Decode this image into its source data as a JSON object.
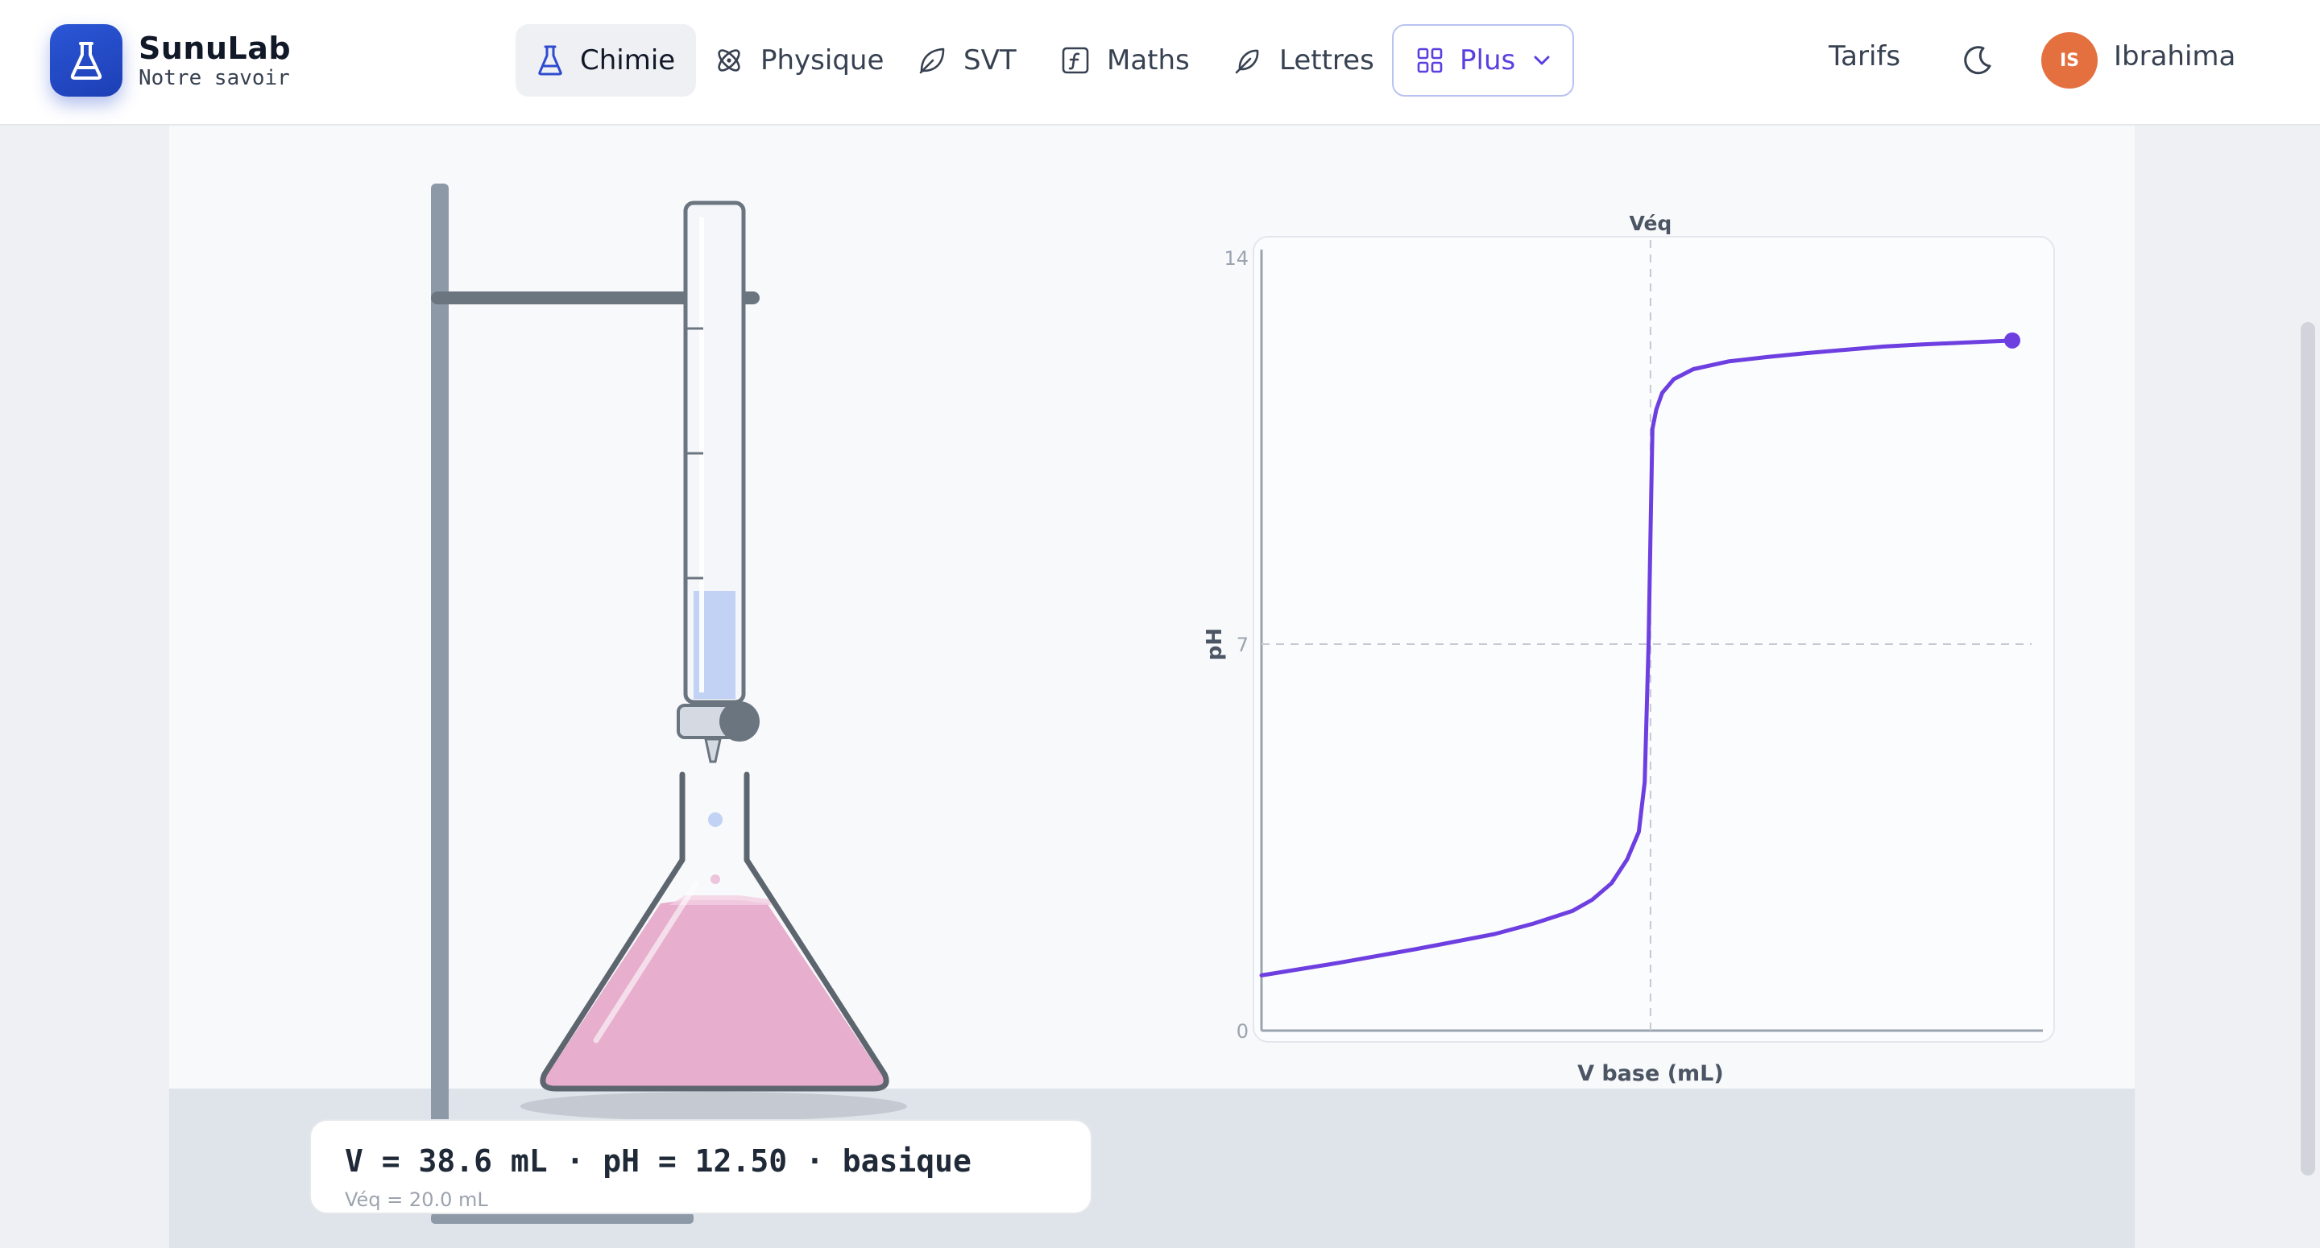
{
  "brand": {
    "name": "SunuLab",
    "tagline": "Notre savoir"
  },
  "nav": {
    "items": [
      {
        "label": "Chimie",
        "icon": "flask-icon",
        "active": true
      },
      {
        "label": "Physique",
        "icon": "atom-icon"
      },
      {
        "label": "SVT",
        "icon": "leaf-icon"
      },
      {
        "label": "Maths",
        "icon": "function-icon"
      },
      {
        "label": "Lettres",
        "icon": "feather-icon"
      }
    ],
    "more_label": "Plus",
    "tarifs_label": "Tarifs"
  },
  "user": {
    "initials": "IS",
    "name": "Ibrahima",
    "avatar_color": "#e4703f"
  },
  "status": {
    "main": "V = 38.6 mL · pH = 12.50 · basique",
    "sub": "Véq = 20.0 mL"
  },
  "colors": {
    "accent": "#5b3fe0",
    "curve": "#6d3fe0",
    "solution_pink": "#e7aecd",
    "titrant_blue": "#c1d2f5"
  },
  "chart_data": {
    "type": "line",
    "title": "",
    "xlabel": "V base (mL)",
    "ylabel": "pH",
    "ylim": [
      0,
      14
    ],
    "xlim": [
      0,
      38.6
    ],
    "yticks": [
      "0",
      "7",
      "14"
    ],
    "equivalence_label": "Véq",
    "equivalence_x": 20.0,
    "neutral_y": 7,
    "grid": false,
    "series": [
      {
        "x": [
          0,
          4,
          8,
          12,
          14,
          16,
          17,
          18,
          18.8,
          19.4,
          19.7,
          19.9,
          20.0,
          20.1,
          20.3,
          20.6,
          21.2,
          22.2,
          24,
          26,
          28,
          30,
          32,
          34,
          36,
          38.6
        ],
        "y": [
          1.0,
          1.23,
          1.48,
          1.75,
          1.94,
          2.17,
          2.37,
          2.67,
          3.1,
          3.6,
          4.5,
          7.0,
          9.0,
          10.9,
          11.25,
          11.55,
          11.8,
          11.98,
          12.12,
          12.2,
          12.27,
          12.33,
          12.39,
          12.43,
          12.46,
          12.5
        ]
      }
    ]
  }
}
